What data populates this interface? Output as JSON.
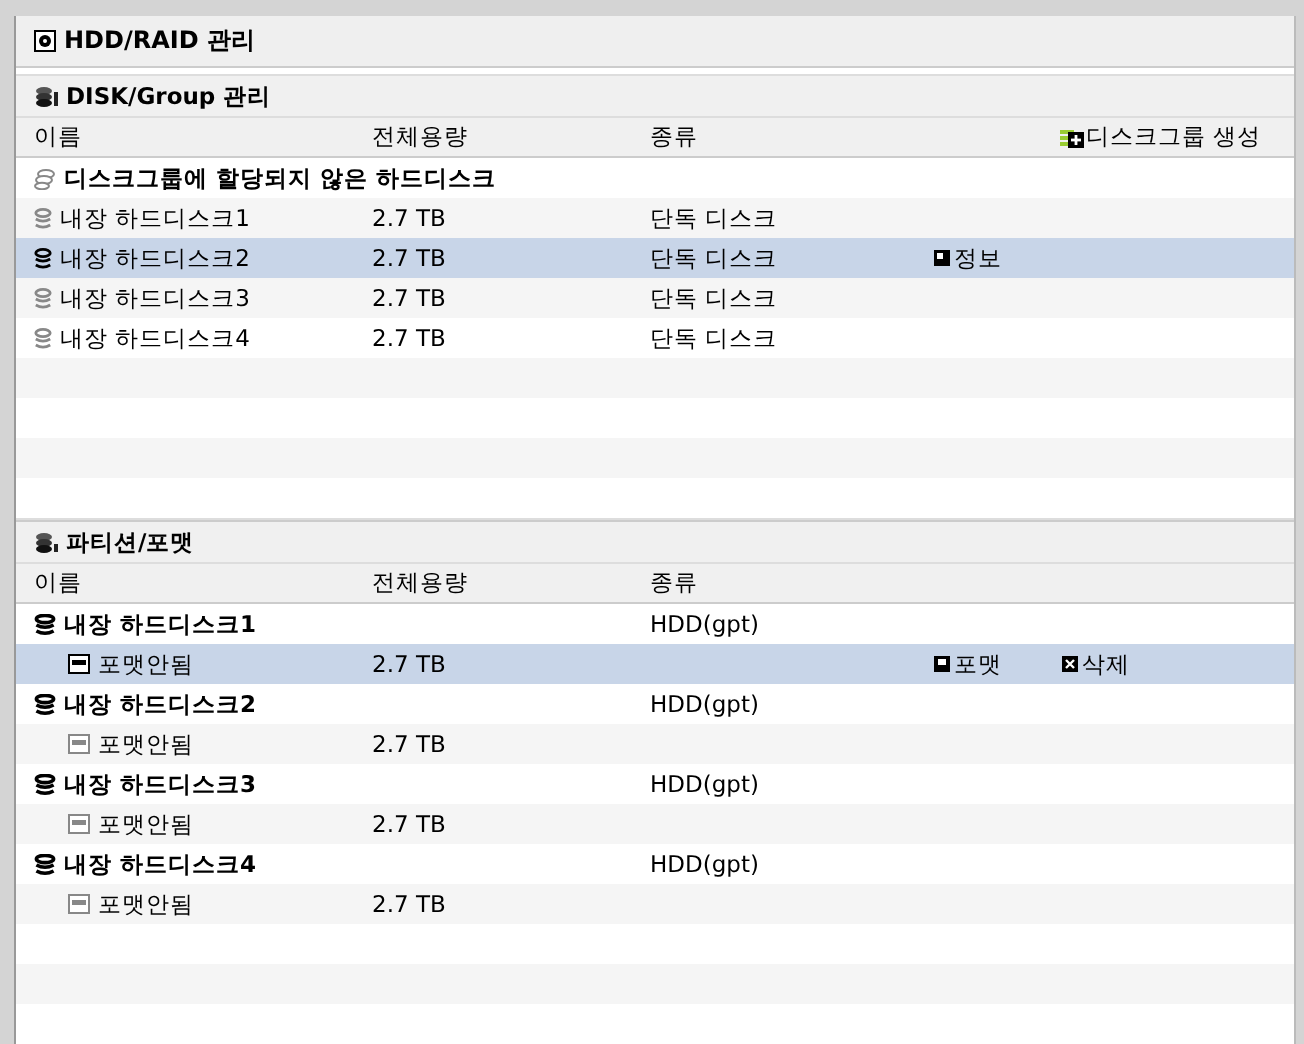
{
  "window": {
    "title": "HDD/RAID 관리"
  },
  "disk_group": {
    "title": "DISK/Group 관리",
    "columns": [
      "이름",
      "전체용량",
      "종류"
    ],
    "create_button": "디스크그룹 생성",
    "group_label": "디스크그룹에 할당되지 않은 하드디스크",
    "rows": [
      {
        "name": "내장 하드디스크1",
        "capacity": "2.7 TB",
        "type": "단독 디스크",
        "selected": false
      },
      {
        "name": "내장 하드디스크2",
        "capacity": "2.7 TB",
        "type": "단독 디스크",
        "selected": true,
        "actions": [
          "정보"
        ]
      },
      {
        "name": "내장 하드디스크3",
        "capacity": "2.7 TB",
        "type": "단독 디스크",
        "selected": false
      },
      {
        "name": "내장 하드디스크4",
        "capacity": "2.7 TB",
        "type": "단독 디스크",
        "selected": false
      }
    ]
  },
  "partition": {
    "title": "파티션/포맷",
    "columns": [
      "이름",
      "전체용량",
      "종류"
    ],
    "disks": [
      {
        "name": "내장 하드디스크1",
        "type": "HDD(gpt)",
        "children": [
          {
            "name": "포맷안됨",
            "capacity": "2.7 TB",
            "selected": true,
            "actions": [
              "포맷",
              "삭제"
            ]
          }
        ]
      },
      {
        "name": "내장 하드디스크2",
        "type": "HDD(gpt)",
        "children": [
          {
            "name": "포맷안됨",
            "capacity": "2.7 TB",
            "selected": false
          }
        ]
      },
      {
        "name": "내장 하드디스크3",
        "type": "HDD(gpt)",
        "children": [
          {
            "name": "포맷안됨",
            "capacity": "2.7 TB",
            "selected": false
          }
        ]
      },
      {
        "name": "내장 하드디스크4",
        "type": "HDD(gpt)",
        "children": [
          {
            "name": "포맷안됨",
            "capacity": "2.7 TB",
            "selected": false
          }
        ]
      }
    ]
  }
}
